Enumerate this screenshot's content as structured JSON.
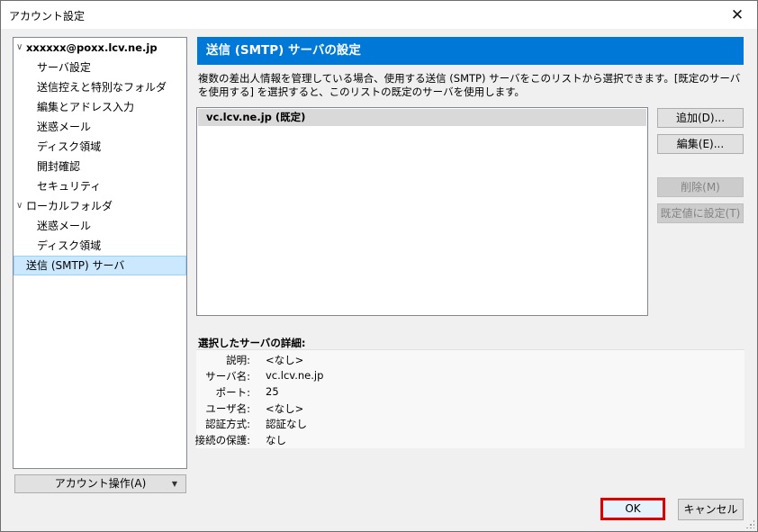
{
  "window": {
    "title": "アカウント設定",
    "close_glyph": "✕"
  },
  "tree": {
    "account": "xxxxxx@poxx.lcv.ne.jp",
    "account_items": [
      "サーバ設定",
      "送信控えと特別なフォルダ",
      "編集とアドレス入力",
      "迷惑メール",
      "ディスク領域",
      "開封確認",
      "セキュリティ"
    ],
    "local": "ローカルフォルダ",
    "local_items": [
      "迷惑メール",
      "ディスク領域"
    ],
    "smtp": "送信 (SMTP) サーバ"
  },
  "account_actions_button": "アカウント操作(A)",
  "panel": {
    "title": "送信 (SMTP) サーバの設定",
    "description": "複数の差出人情報を管理している場合、使用する送信 (SMTP) サーバをこのリストから選択できます。[既定のサーバを使用する] を選択すると、このリストの既定のサーバを使用します。",
    "servers": [
      "vc.lcv.ne.jp (既定)"
    ],
    "buttons": {
      "add": "追加(D)...",
      "edit": "編集(E)...",
      "delete": "削除(M)",
      "set_default": "既定値に設定(T)"
    },
    "details_title": "選択したサーバの詳細:",
    "details": [
      {
        "k": "説明:",
        "v": "<なし>"
      },
      {
        "k": "サーバ名:",
        "v": "vc.lcv.ne.jp"
      },
      {
        "k": "ポート:",
        "v": "25"
      },
      {
        "k": "ユーザ名:",
        "v": "<なし>"
      },
      {
        "k": "認証方式:",
        "v": "認証なし"
      },
      {
        "k": "接続の保護:",
        "v": "なし"
      }
    ]
  },
  "footer": {
    "ok": "OK",
    "cancel": "キャンセル"
  }
}
